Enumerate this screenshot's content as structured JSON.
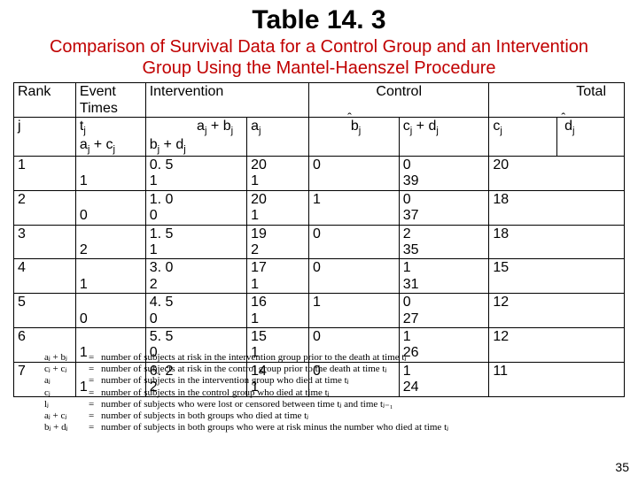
{
  "title": "Table 14. 3",
  "subtitle": "Comparison of Survival Data for a Control Group and an Intervention Group Using the Mantel-Haenszel Procedure",
  "headers": {
    "rank": "Rank",
    "event_times": "Event Times",
    "intervention": "Intervention",
    "control": "Control",
    "total": "Total"
  },
  "subheaders": {
    "j": "j",
    "tj_top": "t",
    "tj_sub": "j",
    "ac": "a",
    "ac_sub": "j",
    "ac2": " + c",
    "ac2_sub": "j",
    "ab": "a",
    "ab_sub": "j",
    "ab2": " + b",
    "ab2_sub": "j",
    "bd": "b",
    "bd_sub": "j",
    "bd2": " + d",
    "bd2_sub": "j",
    "aj": "a",
    "aj_sub": "j",
    "ehat_b": "b",
    "ehat_b_sub": "j",
    "cd": "c",
    "cd_sub": "j",
    "cd2": " + d",
    "cd2_sub": "j",
    "cj": "c",
    "cj_sub": "j",
    "ehat_d": "d",
    "ehat_d_sub": "j"
  },
  "rows": [
    {
      "j": "1",
      "t_top": "",
      "t_bot": "1",
      "c1_top": "0. 5",
      "c1_bot": "1",
      "c2_top": "20",
      "c2_bot": "1",
      "c3_top": "0",
      "c3_bot": "",
      "c4_top": "0",
      "c4_bot": "39",
      "c5_top": "20",
      "c5_bot": ""
    },
    {
      "j": "2",
      "t_top": "",
      "t_bot": "0",
      "c1_top": "1. 0",
      "c1_bot": "0",
      "c2_top": "20",
      "c2_bot": "1",
      "c3_top": "1",
      "c3_bot": "",
      "c4_top": "0",
      "c4_bot": "37",
      "c5_top": "18",
      "c5_bot": ""
    },
    {
      "j": "3",
      "t_top": "",
      "t_bot": "2",
      "c1_top": "1. 5",
      "c1_bot": "1",
      "c2_top": "19",
      "c2_bot": "2",
      "c3_top": "0",
      "c3_bot": "",
      "c4_top": "2",
      "c4_bot": "35",
      "c5_top": "18",
      "c5_bot": ""
    },
    {
      "j": "4",
      "t_top": "",
      "t_bot": "1",
      "c1_top": "3. 0",
      "c1_bot": "2",
      "c2_top": "17",
      "c2_bot": "1",
      "c3_top": "0",
      "c3_bot": "",
      "c4_top": "1",
      "c4_bot": "31",
      "c5_top": "15",
      "c5_bot": ""
    },
    {
      "j": "5",
      "t_top": "",
      "t_bot": "0",
      "c1_top": "4. 5",
      "c1_bot": "0",
      "c2_top": "16",
      "c2_bot": "1",
      "c3_top": "1",
      "c3_bot": "",
      "c4_top": "0",
      "c4_bot": "27",
      "c5_top": "12",
      "c5_bot": ""
    },
    {
      "j": "6",
      "t_top": "",
      "t_bot": "1",
      "c1_top": "5. 5",
      "c1_bot": "0",
      "c2_top": "15",
      "c2_bot": "1",
      "c3_top": "0",
      "c3_bot": "",
      "c4_top": "1",
      "c4_bot": "26",
      "c5_top": "12",
      "c5_bot": ""
    },
    {
      "j": "7",
      "t_top": "",
      "t_bot": "1",
      "c1_top": "6. 2",
      "c1_bot": "2",
      "c2_top": "14",
      "c2_bot": "1",
      "c3_top": "0",
      "c3_bot": "",
      "c4_top": "1",
      "c4_bot": "24",
      "c5_top": "11",
      "c5_bot": ""
    }
  ],
  "defs": [
    {
      "sym": "aⱼ + bⱼ",
      "txt": "number of subjects at risk in the intervention group prior to the death at time  tⱼ"
    },
    {
      "sym": "cⱼ + cⱼ",
      "txt": "number of subjects at risk in the control group prior to the death at time  tⱼ"
    },
    {
      "sym": "aⱼ",
      "txt": "number of subjects in the intervention group who died at time  tⱼ"
    },
    {
      "sym": "cⱼ",
      "txt": "number of subjects in the control group who died at time  tⱼ"
    },
    {
      "sym": "lⱼ",
      "txt": "number of subjects who were lost or censored between time  tⱼ and time  tⱼ₋₁"
    },
    {
      "sym": "aⱼ + cⱼ",
      "txt": "number of subjects in both groups who died at time  tⱼ"
    },
    {
      "sym": "bⱼ + dⱼ",
      "txt": "number of subjects in both groups who were at risk minus the number who died at time  tⱼ"
    }
  ],
  "pagenum": "35"
}
